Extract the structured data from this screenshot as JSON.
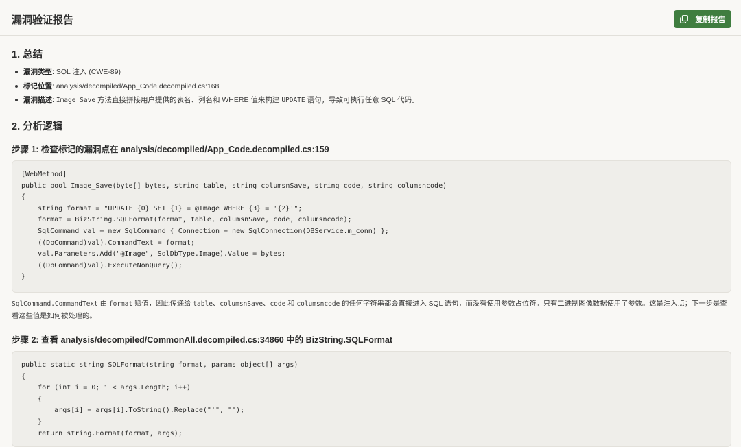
{
  "header": {
    "title": "漏洞验证报告",
    "copy_button_label": "复制报告"
  },
  "summary": {
    "heading": "1. 总结",
    "items": [
      {
        "label": "漏洞类型",
        "text": ": SQL 注入 (CWE-89)"
      },
      {
        "label": "标记位置",
        "text": ": analysis/decompiled/App_Code.decompiled.cs:168"
      },
      {
        "label": "漏洞描述",
        "text_pre": ": ",
        "code": "Image_Save",
        "text": " 方法直接拼接用户提供的表名、列名和 WHERE 值来构建 ",
        "code2": "UPDATE",
        "text2": " 语句，导致可执行任意 SQL 代码。"
      }
    ]
  },
  "analysis": {
    "heading": "2. 分析逻辑",
    "step1": {
      "heading": "步骤 1: 检查标记的漏洞点在 analysis/decompiled/App_Code.decompiled.cs:159",
      "code": "[WebMethod]\npublic bool Image_Save(byte[] bytes, string table, string columsnSave, string code, string columsncode)\n{\n    string format = \"UPDATE {0} SET {1} = @Image WHERE {3} = '{2}'\";\n    format = BizString.SQLFormat(format, table, columsnSave, code, columsncode);\n    SqlCommand val = new SqlCommand { Connection = new SqlConnection(DBService.m_conn) };\n    ((DbCommand)val).CommandText = format;\n    val.Parameters.Add(\"@Image\", SqlDbType.Image).Value = bytes;\n    ((DbCommand)val).ExecuteNonQuery();\n}",
      "explanation": {
        "c1": "SqlCommand.CommandText",
        "t1": " 由 ",
        "c2": "format",
        "t2": " 赋值，因此传递给 ",
        "c3": "table",
        "t3": "、",
        "c4": "columsnSave",
        "t4": "、",
        "c5": "code",
        "t5": " 和 ",
        "c6": "columsncode",
        "t6": " 的任何字符串都会直接进入 SQL 语句，而没有使用参数占位符。只有二进制图像数据使用了参数。这是注入点；下一步是查看这些值是如何被处理的。"
      }
    },
    "step2": {
      "heading": "步骤 2: 查看 analysis/decompiled/CommonAll.decompiled.cs:34860 中的 BizString.SQLFormat",
      "code": "public static string SQLFormat(string format, params object[] args)\n{\n    for (int i = 0; i < args.Length; i++)\n    {\n        args[i] = args[i].ToString().Replace(\"'\", \"\");\n    }\n    return string.Format(format, args);"
    }
  },
  "colors": {
    "accent": "#3f7d3f",
    "background": "#f9f8f5",
    "code_background": "#efeeea"
  },
  "icons": {
    "copy": "copy-icon"
  }
}
